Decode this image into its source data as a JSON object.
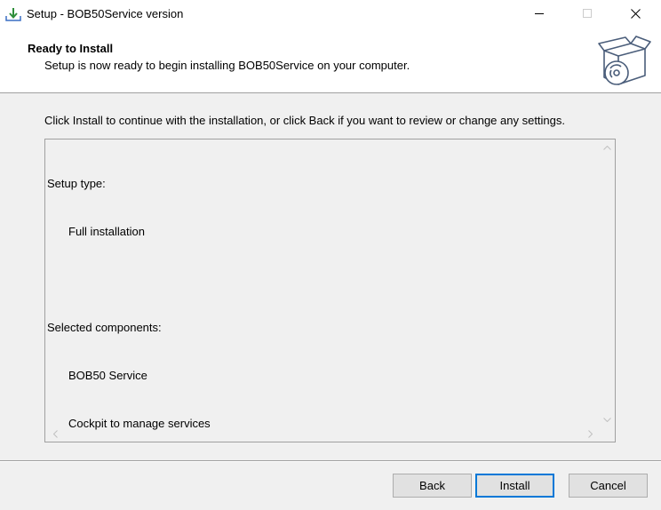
{
  "window": {
    "title": "Setup - BOB50Service version",
    "controls": {
      "minimize_icon": "minimize-icon",
      "maximize_icon": "maximize-icon",
      "close_icon": "close-icon"
    }
  },
  "header": {
    "title": "Ready to Install",
    "subtitle": "Setup is now ready to begin installing BOB50Service on your computer.",
    "icon": "setup-box-icon"
  },
  "main": {
    "instruction": "Click Install to continue with the installation, or click Back if you want to review or change any settings.",
    "memo": {
      "lines": [
        {
          "text": "Setup type:",
          "indent": false
        },
        {
          "text": "Full installation",
          "indent": true
        },
        {
          "text": "",
          "indent": false
        },
        {
          "text": "Selected components:",
          "indent": false
        },
        {
          "text": "BOB50 Service",
          "indent": true
        },
        {
          "text": "Cockpit to manage services",
          "indent": true
        }
      ]
    }
  },
  "buttons": {
    "back": "Back",
    "install": "Install",
    "cancel": "Cancel"
  },
  "colors": {
    "accent": "#0078d7",
    "window_bg": "#f0f0f0",
    "header_bg": "#ffffff"
  }
}
